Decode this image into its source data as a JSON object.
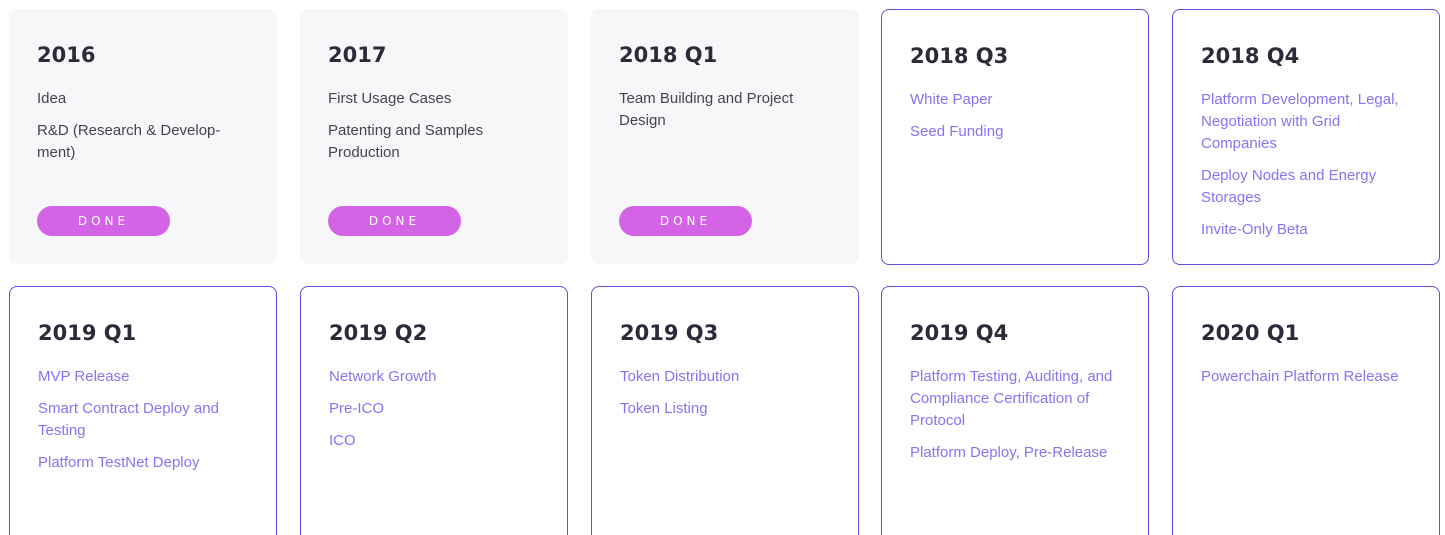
{
  "roadmap": {
    "milestones": [
      {
        "period": "2016",
        "status": "done",
        "items": [
          "Idea",
          "R&D (Research & Develop-ment)"
        ],
        "badge": "DONE"
      },
      {
        "period": "2017",
        "status": "done",
        "items": [
          "First Usage Cases",
          "Patenting and Samples Production"
        ],
        "badge": "DONE"
      },
      {
        "period": "2018 Q1",
        "status": "done",
        "items": [
          "Team Building and Project Design"
        ],
        "badge": "DONE"
      },
      {
        "period": "2018 Q3",
        "status": "future",
        "items": [
          "White Paper",
          "Seed Funding"
        ]
      },
      {
        "period": "2018 Q4",
        "status": "future",
        "items": [
          "Platform Development, Legal, Negotiation with Grid Companies",
          "Deploy Nodes and Energy Storages",
          "Invite-Only Beta"
        ]
      },
      {
        "period": "2019 Q1",
        "status": "future",
        "items": [
          "MVP Release",
          "Smart Contract Deploy and Testing",
          "Platform TestNet Deploy"
        ]
      },
      {
        "period": "2019 Q2",
        "status": "future",
        "items": [
          "Network Growth",
          "Pre-ICO",
          "ICO"
        ]
      },
      {
        "period": "2019 Q3",
        "status": "future",
        "items": [
          "Token Distribution",
          "Token Listing"
        ]
      },
      {
        "period": "2019 Q4",
        "status": "future",
        "items": [
          "Platform Testing, Auditing, and Compliance Certification of Protocol",
          "Platform Deploy, Pre-Release"
        ]
      },
      {
        "period": "2020 Q1",
        "status": "future",
        "items": [
          "Powerchain Platform Release"
        ]
      }
    ],
    "colors": {
      "done_card_bg": "#f7f7f9",
      "future_border": "#5b4fe0",
      "future_text": "#8a72f0",
      "badge_bg": "#d464e6"
    }
  }
}
